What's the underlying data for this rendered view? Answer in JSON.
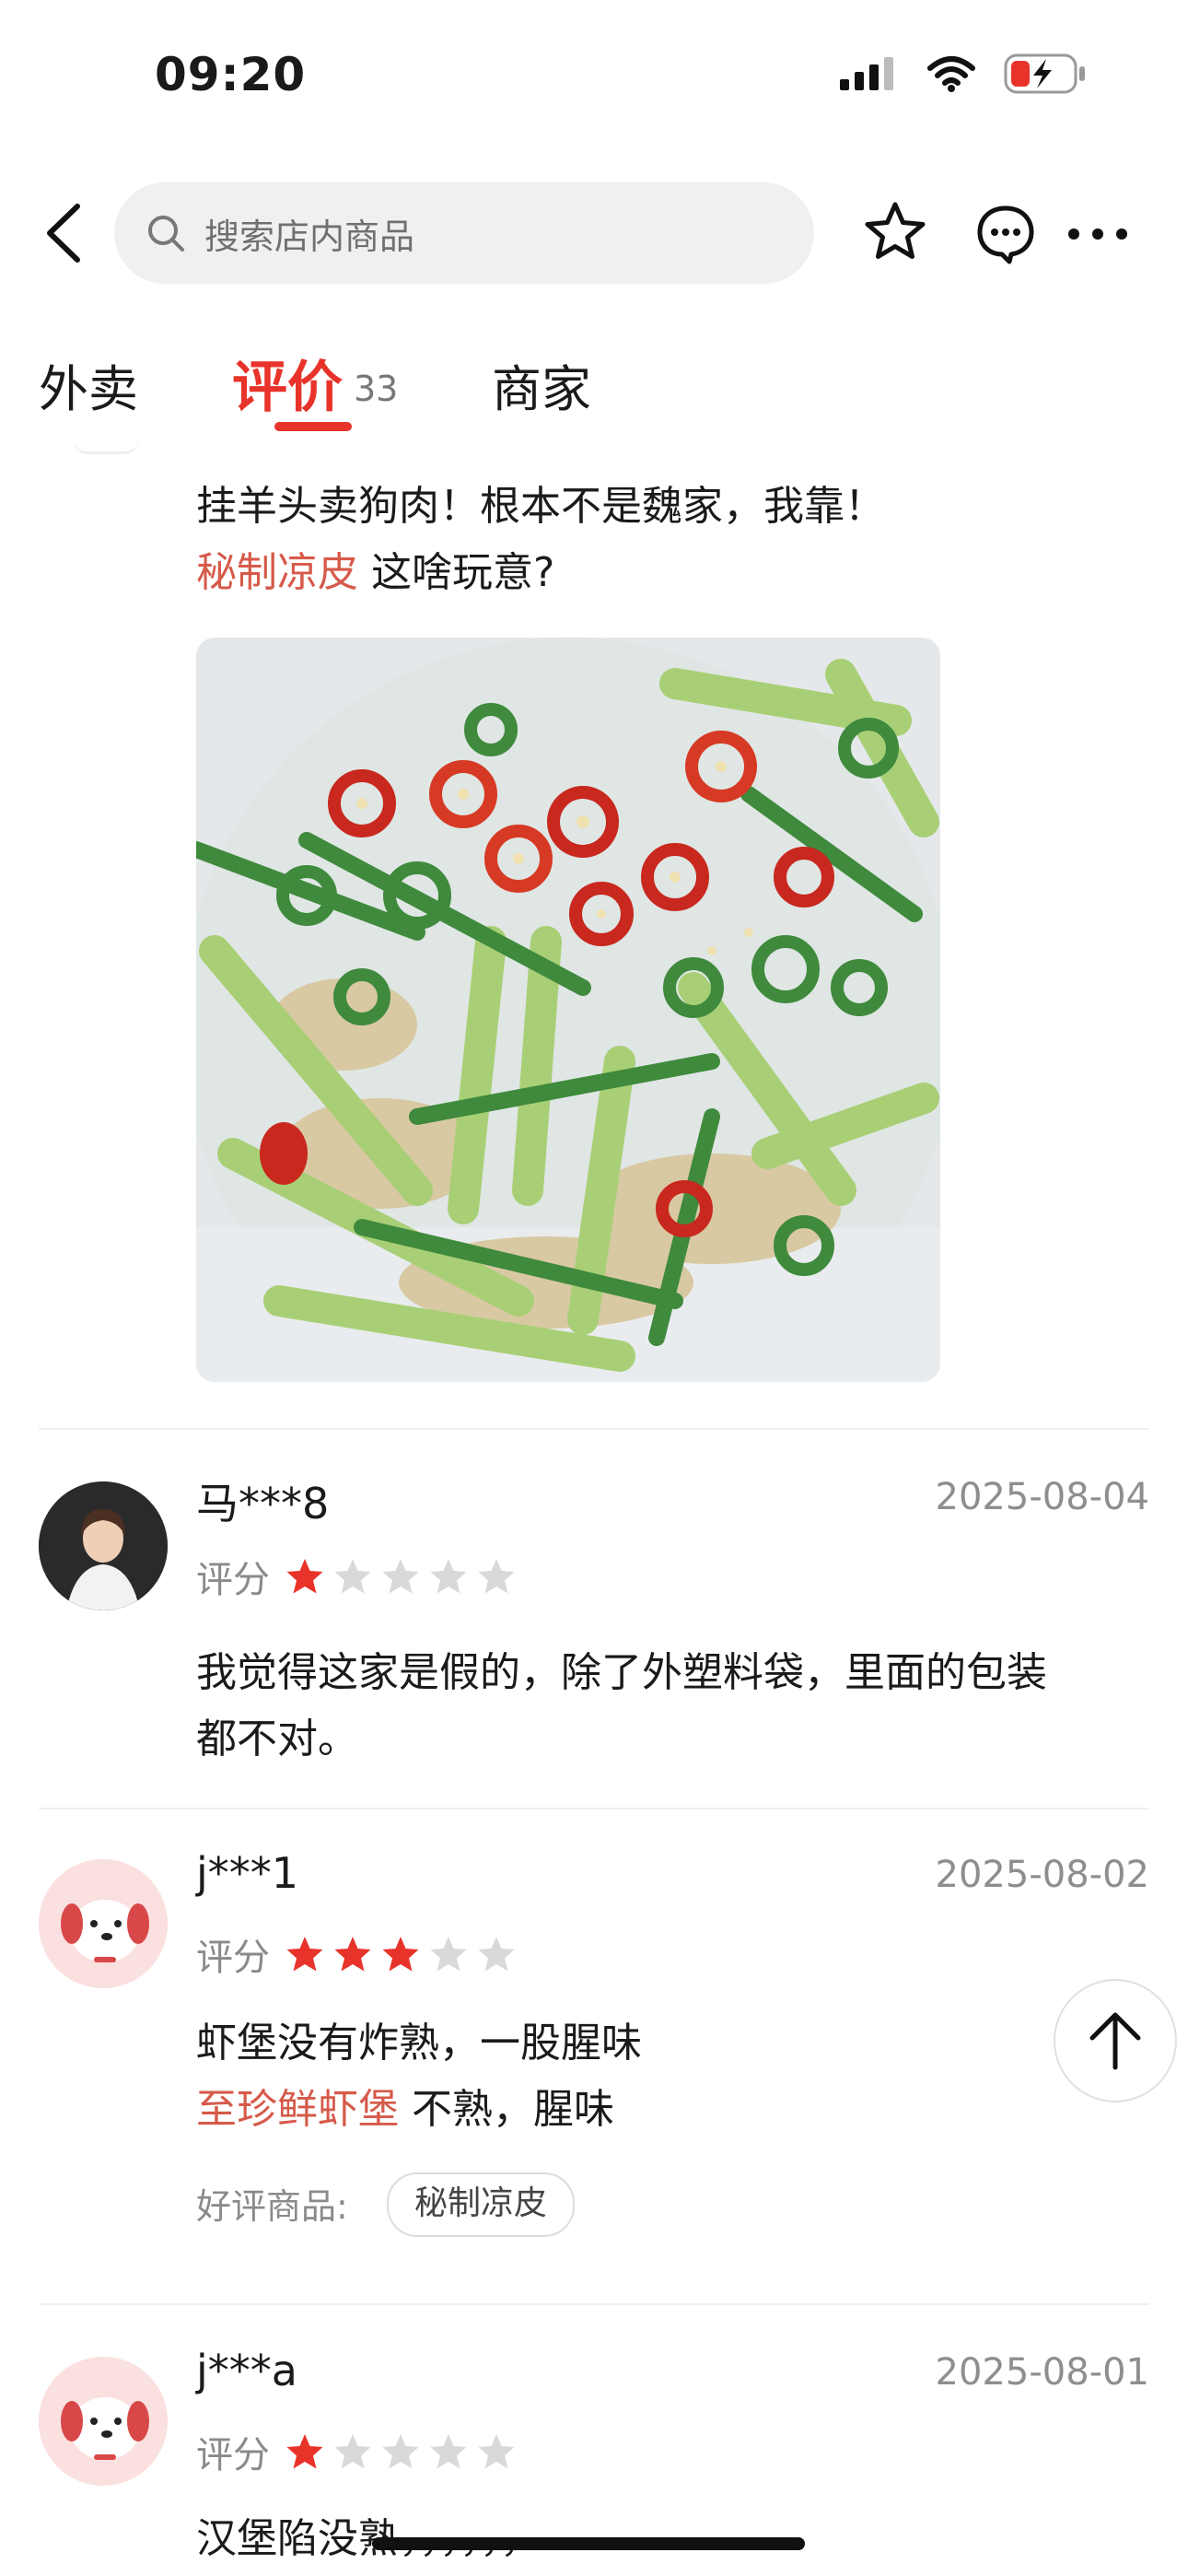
{
  "status": {
    "time": "09:20"
  },
  "search": {
    "placeholder": "搜索店内商品"
  },
  "tabs": {
    "takeout": "外卖",
    "reviews": "评价",
    "reviews_count": "33",
    "merchant": "商家"
  },
  "reviews": [
    {
      "text_line1": "挂羊头卖狗肉！根本不是魏家，我靠！",
      "product_link": "秘制凉皮",
      "product_comment": "这啥玩意?"
    },
    {
      "username": "马***8",
      "date": "2025-08-04",
      "rating_label": "评分",
      "rating": 1,
      "text_line1": "我觉得这家是假的，除了外塑料袋，里面的包装",
      "text_line2": "都不对。"
    },
    {
      "username": "j***1",
      "date": "2025-08-02",
      "rating_label": "评分",
      "rating": 3,
      "text_line1": "虾堡没有炸熟，一股腥味",
      "product_link": "至珍鲜虾堡",
      "product_comment": "不熟，腥味",
      "good_label": "好评商品:",
      "good_tag": "秘制凉皮"
    },
    {
      "username": "j***a",
      "date": "2025-08-01",
      "rating_label": "评分",
      "rating": 1,
      "text_line1": "汉堡陷没熟，，，，，，"
    }
  ],
  "colors": {
    "accent": "#e8332a",
    "link": "#d65a4a",
    "star_on": "#e8332a",
    "star_off": "#d9d9d9"
  }
}
